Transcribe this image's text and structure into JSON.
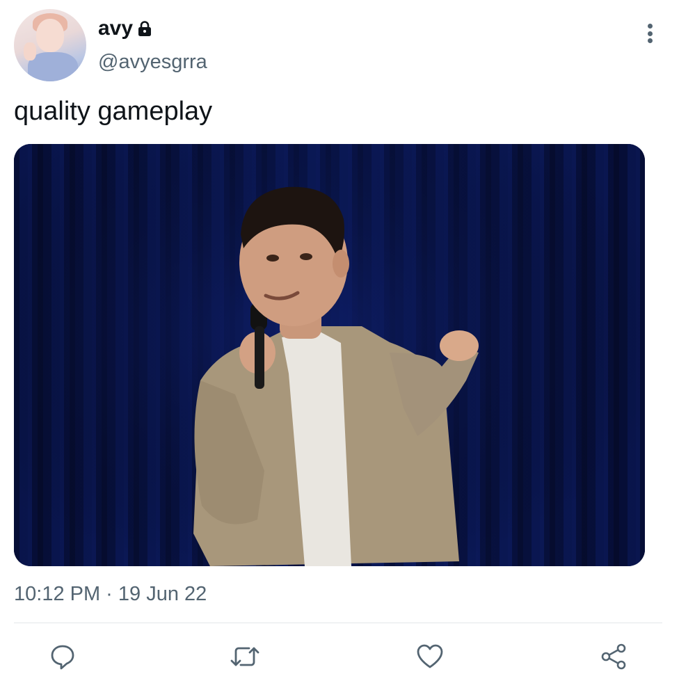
{
  "tweet": {
    "author": {
      "display_name": "avy",
      "handle": "@avyesgrra",
      "locked": true
    },
    "text": "quality gameplay",
    "timestamp": "10:12 PM · 19 Jun 22"
  },
  "icons": {
    "lock": "lock-icon",
    "more": "more-vertical-icon",
    "reply": "reply-icon",
    "retweet": "retweet-icon",
    "like": "like-icon",
    "share": "share-icon"
  },
  "colors": {
    "text_primary": "#0f1419",
    "text_secondary": "#536471",
    "divider": "#e3e7ea",
    "curtain": "#07103a"
  }
}
